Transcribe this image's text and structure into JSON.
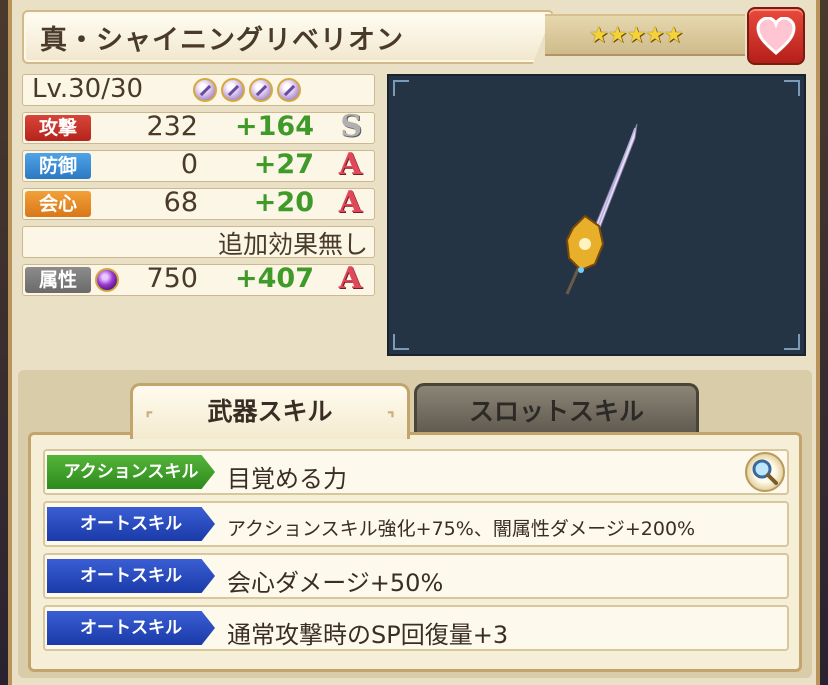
{
  "weapon": {
    "name": "真・シャイニングリベリオン",
    "rarity_stars": 5,
    "stars_text": "★★★★★",
    "level_text": "Lv.30/30",
    "slot_count": 4
  },
  "stats": [
    {
      "label": "攻撃",
      "base": "232",
      "bonus": "+164",
      "grade": "S",
      "color": "red"
    },
    {
      "label": "防御",
      "base": "0",
      "bonus": "+27",
      "grade": "A",
      "color": "blue"
    },
    {
      "label": "会心",
      "base": "68",
      "bonus": "+20",
      "grade": "A",
      "color": "orange"
    }
  ],
  "extra_effect": "追加効果無し",
  "element": {
    "label": "属性",
    "base": "750",
    "bonus": "+407",
    "grade": "A",
    "icon": "dark-element-icon"
  },
  "tabs": [
    {
      "label": "武器スキル",
      "active": true
    },
    {
      "label": "スロットスキル",
      "active": false
    }
  ],
  "skills": [
    {
      "type": "アクションスキル",
      "text": "目覚める力",
      "badge_color": "#2d8a1c"
    },
    {
      "type": "オートスキル",
      "text": "アクションスキル強化+75%、闇属性ダメージ+200%",
      "badge_color": "#1a3aa8"
    },
    {
      "type": "オートスキル",
      "text": "会心ダメージ+50%",
      "badge_color": "#1a3aa8"
    },
    {
      "type": "オートスキル",
      "text": "通常攻撃時のSP回復量+3",
      "badge_color": "#1a3aa8"
    }
  ],
  "icons": {
    "favorite": "heart-icon",
    "detail": "magnify-icon",
    "slot": "sword-slot-icon"
  }
}
